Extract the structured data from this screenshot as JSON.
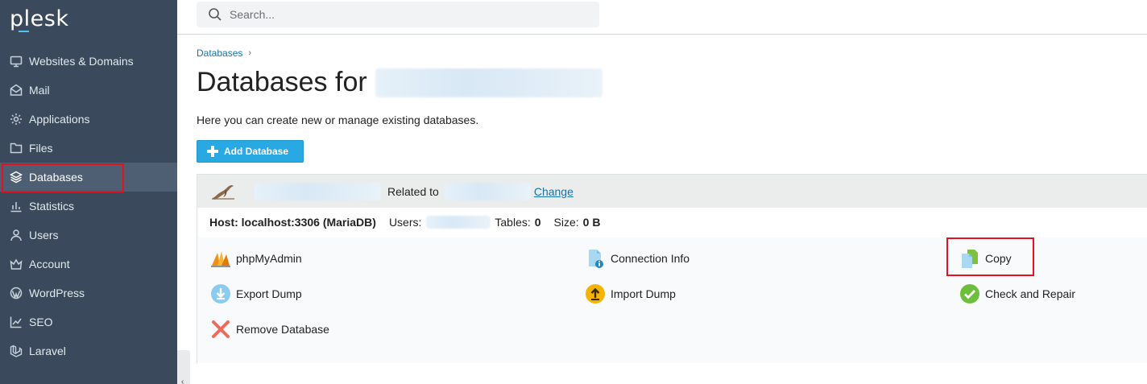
{
  "app": {
    "logo": "plesk"
  },
  "sidebar": {
    "items": [
      {
        "label": "Websites & Domains",
        "icon": "monitor-icon"
      },
      {
        "label": "Mail",
        "icon": "mail-icon"
      },
      {
        "label": "Applications",
        "icon": "gear-icon"
      },
      {
        "label": "Files",
        "icon": "folder-icon"
      },
      {
        "label": "Databases",
        "icon": "layers-icon",
        "active": true
      },
      {
        "label": "Statistics",
        "icon": "bar-chart-icon"
      },
      {
        "label": "Users",
        "icon": "user-icon"
      },
      {
        "label": "Account",
        "icon": "crown-icon"
      },
      {
        "label": "WordPress",
        "icon": "wordpress-icon"
      },
      {
        "label": "SEO",
        "icon": "trend-chart-icon"
      },
      {
        "label": "Laravel",
        "icon": "laravel-icon"
      }
    ]
  },
  "search": {
    "placeholder": "Search..."
  },
  "breadcrumb": {
    "item": "Databases",
    "separator": "›"
  },
  "page": {
    "title": "Databases for",
    "description": "Here you can create new or manage existing databases.",
    "add_button": "Add Database"
  },
  "database": {
    "related_label": "Related to",
    "change_link": "Change",
    "host_label": "Host: localhost:3306 (MariaDB)",
    "users_label": "Users:",
    "tables_label": "Tables:",
    "tables_value": "0",
    "size_label": "Size:",
    "size_value": "0 B"
  },
  "actions": [
    {
      "label": "phpMyAdmin",
      "icon": "phpmyadmin-icon"
    },
    {
      "label": "Connection Info",
      "icon": "info-document-icon"
    },
    {
      "label": "Copy",
      "icon": "copy-icon"
    },
    {
      "label": "Export Dump",
      "icon": "download-icon"
    },
    {
      "label": "Import Dump",
      "icon": "upload-icon"
    },
    {
      "label": "Check and Repair",
      "icon": "checkmark-icon"
    },
    {
      "label": "Remove Database",
      "icon": "remove-icon"
    }
  ],
  "colors": {
    "sidebar_bg": "#3a4a5c",
    "accent": "#28a9e1",
    "link": "#1772a8",
    "highlight": "#e0141e"
  }
}
